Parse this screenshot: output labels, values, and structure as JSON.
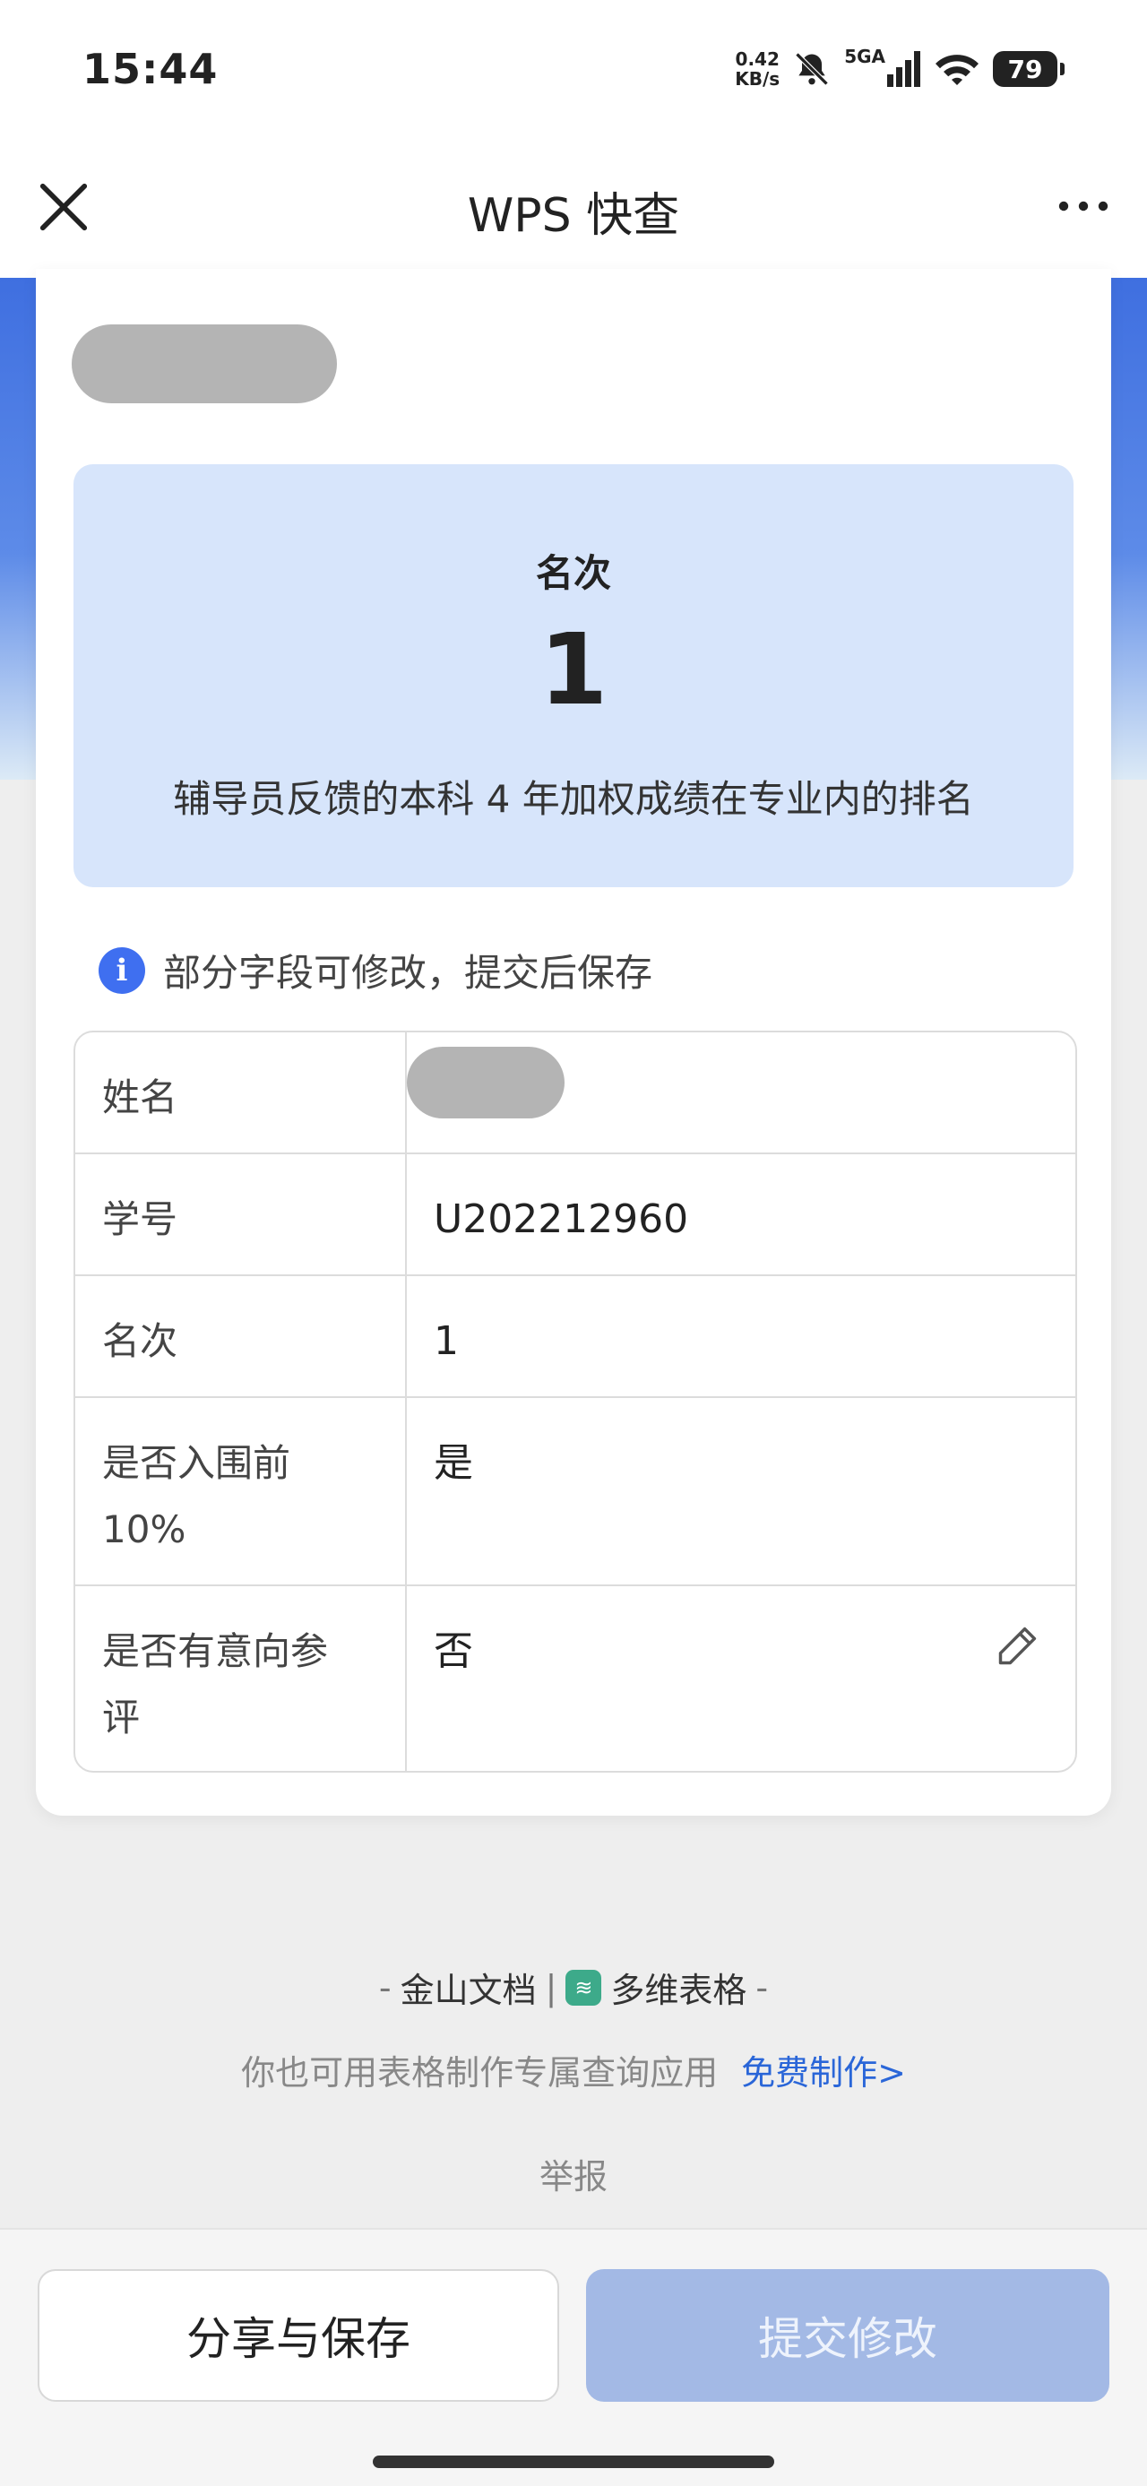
{
  "status_bar": {
    "time": "15:44",
    "net_speed_value": "0.42",
    "net_speed_unit": "KB/s",
    "network": "5GA",
    "battery": "79"
  },
  "nav": {
    "title": "WPS 快查"
  },
  "rank_card": {
    "label": "名次",
    "value": "1",
    "description": "辅导员反馈的本科 4 年加权成绩在专业内的排名"
  },
  "notice": {
    "text": "部分字段可修改，提交后保存"
  },
  "table": {
    "rows": [
      {
        "key_lines": [
          "姓名"
        ],
        "value": ""
      },
      {
        "key_lines": [
          "学号"
        ],
        "value": "U202212960"
      },
      {
        "key_lines": [
          "名次"
        ],
        "value": "1"
      },
      {
        "key_lines": [
          "是否入围前",
          "10%"
        ],
        "value": "是"
      },
      {
        "key_lines": [
          "是否有意向参",
          "评"
        ],
        "value": "否",
        "editable": true
      }
    ]
  },
  "footer": {
    "brand_left": "金山文档",
    "separator": "|",
    "brand_right": "多维表格",
    "promo_text": "你也可用表格制作专属查询应用",
    "promo_link": "免费制作>",
    "report": "举报"
  },
  "actions": {
    "share_label": "分享与保存",
    "submit_label": "提交修改"
  },
  "colors": {
    "accent_blue": "#3f6ff0",
    "rank_bg": "#d7e5fb",
    "submit_disabled": "#a3b9e5",
    "link": "#2a66d8"
  }
}
